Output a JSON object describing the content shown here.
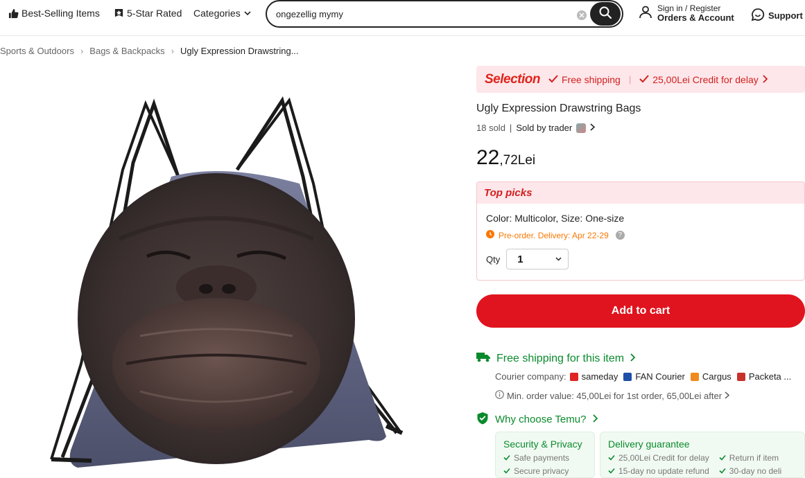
{
  "header": {
    "best_selling": "Best-Selling Items",
    "five_star": "5-Star Rated",
    "categories": "Categories",
    "search_value": "ongezellig mymy",
    "sign_in": "Sign in / Register",
    "orders_account": "Orders & Account",
    "support": "Support"
  },
  "breadcrumb": [
    "Sports & Outdoors",
    "Bags & Backpacks",
    "Ugly Expression Drawstring..."
  ],
  "selection": {
    "brand": "Selection",
    "free_shipping": "Free shipping",
    "credit": "25,00Lei Credit for delay"
  },
  "product": {
    "title": "Ugly Expression Drawstring Bags",
    "sold": "18 sold",
    "sold_by": "Sold by trader",
    "price_int": "22",
    "price_rest": ",72Lei"
  },
  "top_picks": {
    "label": "Top picks",
    "color_label": "Color:",
    "color_value": "Multicolor,",
    "size_label": "Size:",
    "size_value": "One-size",
    "preorder": "Pre-order. Delivery: Apr 22-29",
    "qty_label": "Qty",
    "qty_value": "1"
  },
  "cart_button": "Add to cart",
  "shipping": {
    "title": "Free shipping for this item",
    "courier_label": "Courier company:",
    "couriers": [
      "sameday",
      "FAN Courier",
      "Cargus",
      "Packeta ..."
    ],
    "min_order": "Min. order value: 45,00Lei for 1st order, 65,00Lei after"
  },
  "why": {
    "title": "Why choose Temu?",
    "security": {
      "title": "Security & Privacy",
      "items": [
        "Safe payments",
        "Secure privacy"
      ]
    },
    "delivery": {
      "title": "Delivery guarantee",
      "col1": [
        "25,00Lei Credit for delay",
        "15-day no update refund"
      ],
      "col2": [
        "Return if item",
        "30-day no deli"
      ]
    }
  },
  "colors": {
    "accent_red": "#e0141e",
    "green": "#0a8a2c",
    "orange": "#fb7701",
    "pink_bg": "#fde7ea"
  }
}
